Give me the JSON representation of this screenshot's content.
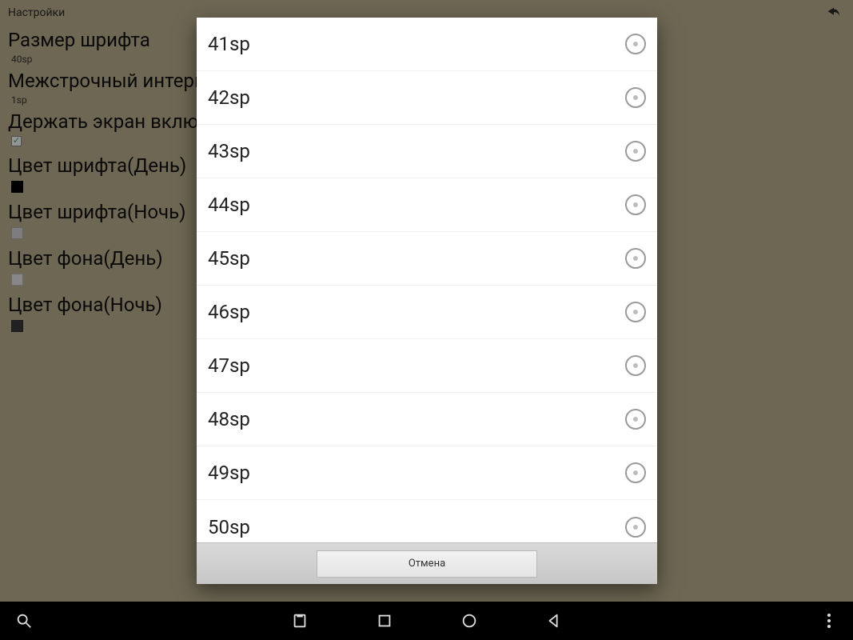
{
  "actionbar": {
    "title": "Настройки"
  },
  "settings": [
    {
      "title": "Размер шрифта",
      "sub": "40sp",
      "kind": "text"
    },
    {
      "title": "Межстрочный интервал",
      "sub": "1sp",
      "kind": "text"
    },
    {
      "title": "Держать экран включенным",
      "kind": "check"
    },
    {
      "title": "Цвет шрифта(День)",
      "kind": "swatch",
      "color": "#000000"
    },
    {
      "title": "Цвет шрифта(Ночь)",
      "kind": "swatch",
      "color": "#d8d8d8"
    },
    {
      "title": "Цвет фона(День)",
      "kind": "swatch",
      "color": "#e8e8e8"
    },
    {
      "title": "Цвет фона(Ночь)",
      "kind": "swatch",
      "color": "#3a3a3a"
    }
  ],
  "dialog": {
    "options": [
      "41sp",
      "42sp",
      "43sp",
      "44sp",
      "45sp",
      "46sp",
      "47sp",
      "48sp",
      "49sp",
      "50sp"
    ],
    "cancel": "Отмена"
  }
}
